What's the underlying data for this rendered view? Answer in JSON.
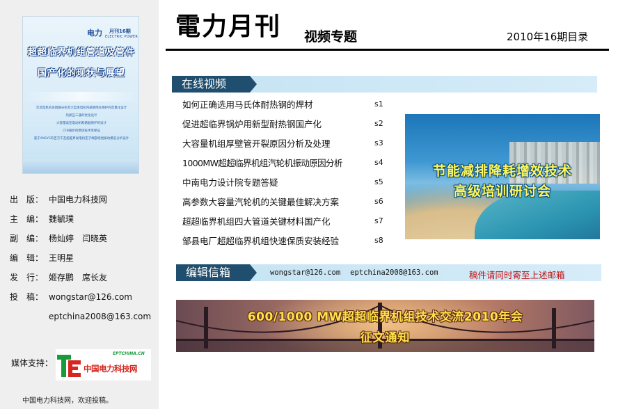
{
  "sidebar": {
    "cover": {
      "brand": "电力",
      "issue": "月刊16期",
      "subtitle": "ELECTRIC POWER",
      "title_line1": "超超临界机组管道及管件",
      "title_line2": "国产化的现状与展望",
      "lines": [
        "交流电机的多回路分析及大型发电机内部故障主保护的定量化设计",
        "热损压三通的优化设计",
        "大容量高压电动机断路器保护的设计",
        "CFB锅炉的燃烧技术等保证",
        "基于ANSYS的百万千瓦超临界发电机定子端部绕组振动模态分析设计"
      ]
    },
    "credits": [
      {
        "label": "出　版：",
        "value": "中国电力科技网"
      },
      {
        "label": "主　编：",
        "value": "魏毓璞"
      },
      {
        "label": "副　编：",
        "value": "杨灿婷　闫晓英"
      },
      {
        "label": "编　辑：",
        "value": "王明星"
      },
      {
        "label": "发　行：",
        "value": "姬存鹏　席长友"
      },
      {
        "label": "投　稿：",
        "value": "wongstar@126.com"
      }
    ],
    "credit_extra": "eptchina2008@163.com",
    "media_label": "媒体支持：",
    "media_logo": {
      "url_text": "EPTCHINA.CN",
      "name": "中国电力科技网",
      "mark_color": "#1a9b3a",
      "accent_color": "#d6261f"
    },
    "footer_note": "中国电力科技网，欢迎投稿。"
  },
  "header": {
    "title": "電力月刊",
    "subtitle": "视频专题",
    "issue_label": "2010年16期目录"
  },
  "online_video": {
    "label": "在线视频",
    "articles": [
      {
        "title": "如何正确选用马氏体耐热钢的焊材",
        "code": "s1"
      },
      {
        "title": "促进超临界锅炉用新型耐热钢国产化",
        "code": "s2"
      },
      {
        "title": "大容量机组厚壁管开裂原因分析及处理",
        "code": "s3"
      },
      {
        "title": "1000MW超超临界机组汽轮机振动原因分析",
        "code": "s4"
      },
      {
        "title": "中南电力设计院专题答疑",
        "code": "s5"
      },
      {
        "title": "高参数大容量汽轮机的关键最佳解决方案",
        "code": "s6"
      },
      {
        "title": "超超临界机组四大管道关键材料国产化",
        "code": "s7"
      },
      {
        "title": "邹县电厂超超临界机组快速保质安装经验",
        "code": "s8"
      }
    ],
    "promo": {
      "line1": "节能减排降耗增效技术",
      "line2": "高级培训研讨会"
    }
  },
  "mailbox": {
    "label": "编辑信箱",
    "email1": "wongstar@126.com",
    "email2": "eptchina2008@163.com",
    "note": "稿件请同时寄至上述邮箱"
  },
  "banner": {
    "line1": "600/1000 MW超超临界机组技术交流2010年会",
    "line2": "征文通知"
  },
  "colors": {
    "section_tag": "#1f4e6e",
    "section_bar": "#d6ecf8",
    "note_red": "#c01010",
    "banner_text": "#ffe24a"
  }
}
